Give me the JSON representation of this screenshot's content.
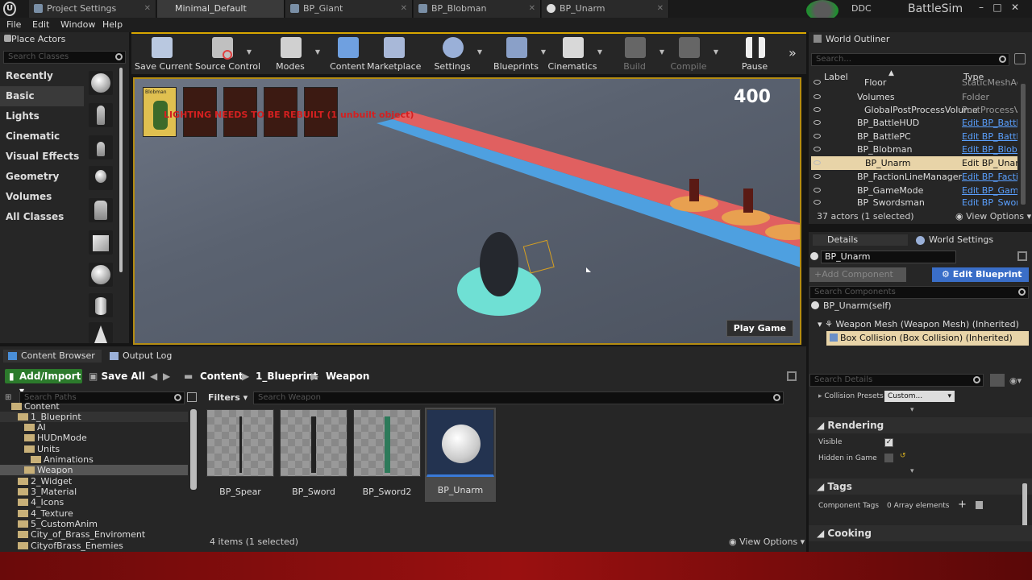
{
  "app": {
    "name": "BattleSim",
    "ddc": "DDC"
  },
  "tabs": [
    {
      "label": "Project Settings"
    },
    {
      "label": "Minimal_Default"
    },
    {
      "label": "BP_Giant"
    },
    {
      "label": "BP_Blobman"
    },
    {
      "label": "BP_Unarm"
    }
  ],
  "menu": [
    "File",
    "Edit",
    "Window",
    "Help"
  ],
  "place_actors": {
    "title": "Place Actors",
    "search_placeholder": "Search Classes",
    "categories": [
      "Recently Placed",
      "Basic",
      "Lights",
      "Cinematic",
      "Visual Effects",
      "Geometry",
      "Volumes",
      "All Classes"
    ]
  },
  "toolbar": [
    {
      "label": "Save Current",
      "icon": "save-icon",
      "color": "#b9c8e0"
    },
    {
      "label": "Source Control",
      "icon": "source-control-icon",
      "color": "#c0c0c0"
    },
    {
      "label": "Modes",
      "icon": "modes-icon",
      "color": "#d0d0d0"
    },
    {
      "label": "Content",
      "icon": "content-icon",
      "color": "#6fa0e0"
    },
    {
      "label": "Marketplace",
      "icon": "marketplace-icon",
      "color": "#a8b8d8"
    },
    {
      "label": "Settings",
      "icon": "settings-icon",
      "color": "#9ab0d8"
    },
    {
      "label": "Blueprints",
      "icon": "blueprints-icon",
      "color": "#8aa0c8"
    },
    {
      "label": "Cinematics",
      "icon": "cinematics-icon",
      "color": "#d8d8d8"
    },
    {
      "label": "Build",
      "icon": "build-icon",
      "color": "#666666"
    },
    {
      "label": "Compile",
      "icon": "compile-icon",
      "color": "#666666"
    },
    {
      "label": "Pause",
      "icon": "pause-icon",
      "color": "#eeeeee"
    }
  ],
  "viewport": {
    "score": "400",
    "warning": "LIGHTING NEEDS TO BE REBUILT (1 unbuilt object)",
    "card_label": "Blobman",
    "play_button": "Play Game"
  },
  "bottom_tabs": [
    "Content Browser",
    "Output Log"
  ],
  "content_browser": {
    "add_import": "Add/Import",
    "save_all": "Save All",
    "breadcrumb": [
      "Content",
      "1_Blueprint",
      "Weapon"
    ],
    "search_paths": "Search Paths",
    "filters": "Filters",
    "search_placeholder": "Search Weapon",
    "tree": [
      {
        "label": "Content",
        "indent": 0
      },
      {
        "label": "1_Blueprint",
        "indent": 1
      },
      {
        "label": "AI",
        "indent": 2
      },
      {
        "label": "HUDnMode",
        "indent": 2
      },
      {
        "label": "Units",
        "indent": 2
      },
      {
        "label": "Animations",
        "indent": 3
      },
      {
        "label": "Weapon",
        "indent": 2,
        "selected": true
      },
      {
        "label": "2_Widget",
        "indent": 1
      },
      {
        "label": "3_Material",
        "indent": 1
      },
      {
        "label": "4_Icons",
        "indent": 1
      },
      {
        "label": "4_Texture",
        "indent": 1
      },
      {
        "label": "5_CustomAnim",
        "indent": 1
      },
      {
        "label": "City_of_Brass_Enviroment",
        "indent": 1
      },
      {
        "label": "CityofBrass_Enemies",
        "indent": 1
      }
    ],
    "assets": [
      {
        "label": "BP_Spear"
      },
      {
        "label": "BP_Sword"
      },
      {
        "label": "BP_Sword2"
      },
      {
        "label": "BP_Unarm",
        "selected": true
      }
    ],
    "status": "4 items (1 selected)",
    "view_options": "View Options"
  },
  "outliner": {
    "title": "World Outliner",
    "search_placeholder": "Search...",
    "col_label": "Label",
    "col_type": "Type",
    "rows": [
      {
        "label": "Floor",
        "type": "StaticMeshActor",
        "folder": true
      },
      {
        "label": "Volumes",
        "type": "Folder",
        "folder": true
      },
      {
        "label": "GlobalPostProcessVolume",
        "type": "PostProcessVolume",
        "folder": true
      },
      {
        "label": "BP_BattleHUD",
        "type": "Edit BP_BattleHUD"
      },
      {
        "label": "BP_BattlePC",
        "type": "Edit BP_BattlePC"
      },
      {
        "label": "BP_Blobman",
        "type": "Edit BP_Blobman"
      },
      {
        "label": "BP_Unarm",
        "type": "Edit BP_Unarm",
        "selected": true
      },
      {
        "label": "BP_FactionLineManager",
        "type": "Edit BP_FactionLineManager"
      },
      {
        "label": "BP_GameMode",
        "type": "Edit BP_GameMode"
      },
      {
        "label": "BP_Swordsman",
        "type": "Edit BP_Swordsman"
      }
    ],
    "status": "37 actors (1 selected)",
    "view_options": "View Options"
  },
  "details": {
    "tab_details": "Details",
    "tab_world": "World Settings",
    "name": "BP_Unarm",
    "add_component": "+Add Component",
    "edit_blueprint": "Edit Blueprint",
    "search_components": "Search Components",
    "self": "BP_Unarm(self)",
    "comp1": "Weapon Mesh (Weapon Mesh) (Inherited)",
    "comp2": "Box Collision (Box Collision) (Inherited)",
    "search_details": "Search Details",
    "collision_presets": "Collision Presets",
    "collision_value": "Custom...",
    "rendering": "Rendering",
    "visible": "Visible",
    "hidden_in_game": "Hidden in Game",
    "tags": "Tags",
    "component_tags": "Component Tags",
    "array_elements": "0 Array elements",
    "cooking": "Cooking"
  }
}
